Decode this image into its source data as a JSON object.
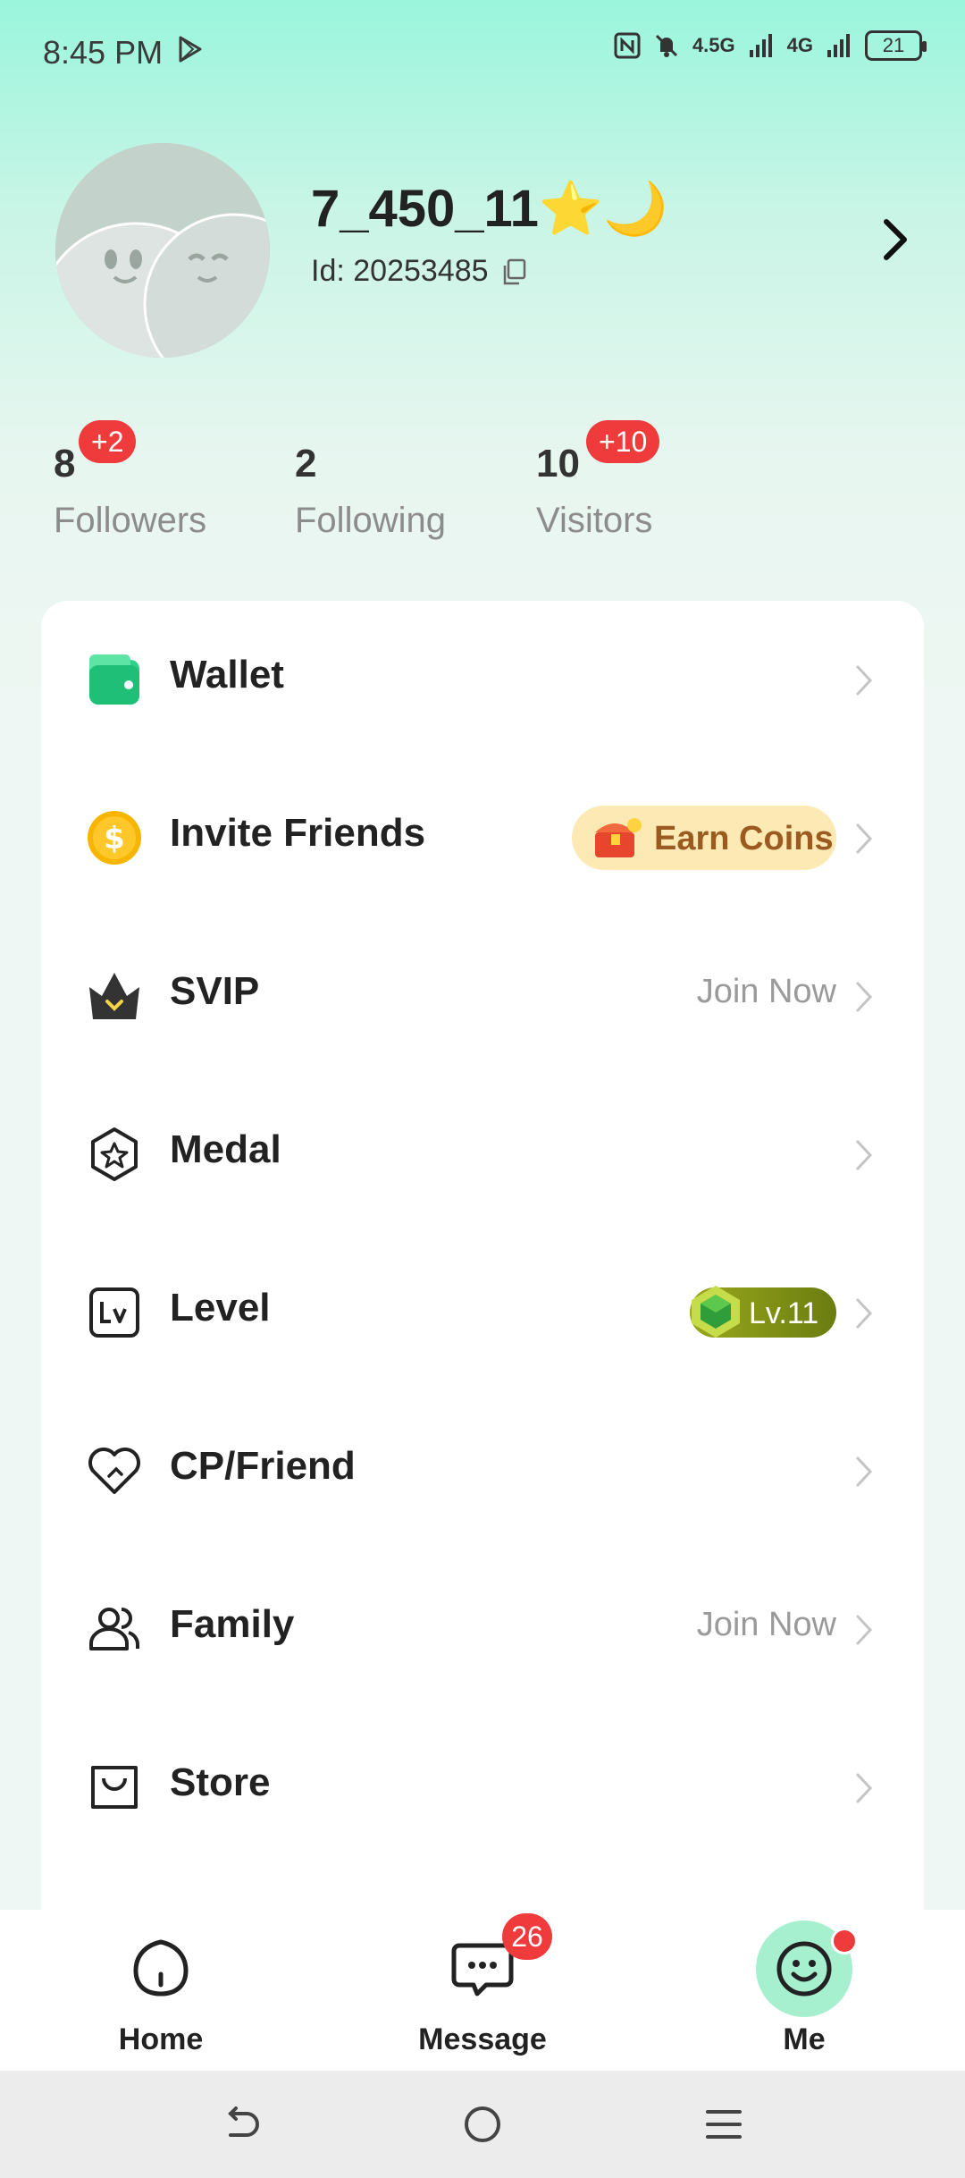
{
  "status_bar": {
    "time": "8:45 PM",
    "network_1": "4.5G",
    "network_2": "4G",
    "battery": "21"
  },
  "profile": {
    "username": "7_450_11⭐🌙",
    "id_text": "Id: 20253485"
  },
  "stats": [
    {
      "count": "8",
      "label": "Followers",
      "badge": "+2"
    },
    {
      "count": "2",
      "label": "Following",
      "badge": ""
    },
    {
      "count": "10",
      "label": "Visitors",
      "badge": "+10"
    }
  ],
  "menu": {
    "wallet": {
      "label": "Wallet"
    },
    "invite": {
      "label": "Invite Friends",
      "extra": "Earn Coins"
    },
    "svip": {
      "label": "SVIP",
      "extra": "Join Now"
    },
    "medal": {
      "label": "Medal"
    },
    "level": {
      "label": "Level",
      "extra": "Lv.11"
    },
    "cp": {
      "label": "CP/Friend"
    },
    "family": {
      "label": "Family",
      "extra": "Join Now"
    },
    "store": {
      "label": "Store"
    }
  },
  "bottom_nav": {
    "home": {
      "label": "Home"
    },
    "message": {
      "label": "Message",
      "badge": "26"
    },
    "me": {
      "label": "Me"
    }
  },
  "colors": {
    "accent_mint": "#9af5dc",
    "badge_red": "#ef3b3b",
    "earn_pill": "#fde9b4",
    "level_pill": "#8a9a16"
  }
}
